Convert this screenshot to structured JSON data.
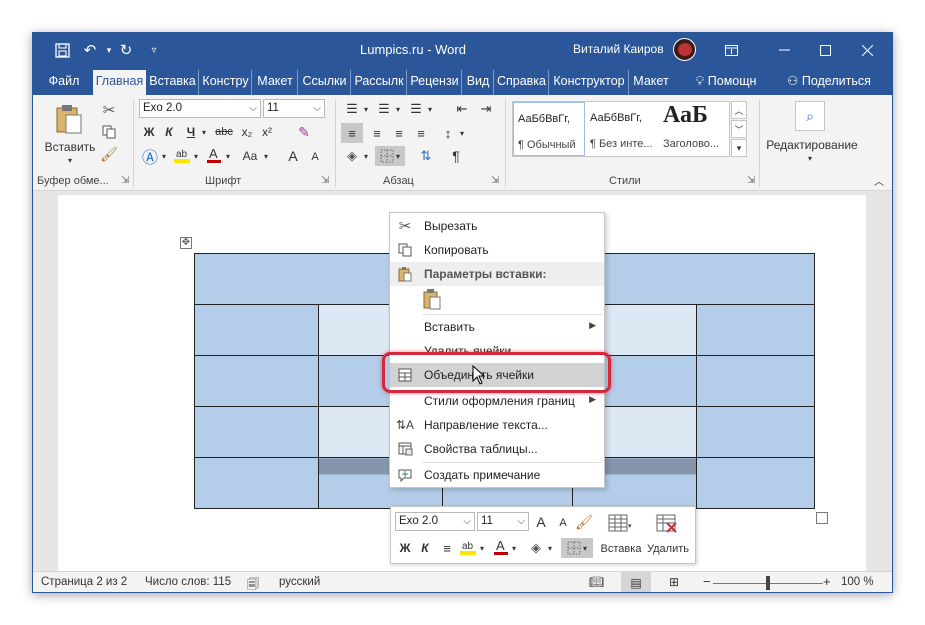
{
  "window": {
    "title": "Lumpics.ru  -  Word",
    "user_name": "Виталий Каиров"
  },
  "tabs": [
    {
      "label": "Файл",
      "active": false
    },
    {
      "label": "Главная",
      "active": true
    },
    {
      "label": "Вставка",
      "active": false
    },
    {
      "label": "Констру",
      "active": false
    },
    {
      "label": "Макет",
      "active": false
    },
    {
      "label": "Ссылки",
      "active": false
    },
    {
      "label": "Рассылк",
      "active": false
    },
    {
      "label": "Рецензи",
      "active": false
    },
    {
      "label": "Вид",
      "active": false
    },
    {
      "label": "Справка",
      "active": false
    },
    {
      "label": "Конструктор",
      "active": false
    },
    {
      "label": "Макет",
      "active": false
    }
  ],
  "tell_me": "Помощн",
  "share": "Поделиться",
  "ribbon": {
    "clipboard": {
      "paste_label": "Вставить",
      "group_label": "Буфер обме..."
    },
    "font": {
      "font_name": "Exo 2.0",
      "font_size": "11",
      "bold": "Ж",
      "italic": "К",
      "underline": "Ч",
      "strike": "abc",
      "subscript": "x₂",
      "superscript": "x²",
      "grow": "A",
      "shrink": "A",
      "case": "Aa",
      "group_label": "Шрифт"
    },
    "paragraph": {
      "group_label": "Абзац",
      "pilcrow": "¶"
    },
    "styles": {
      "items": [
        {
          "sample": "АаБбВвГг,",
          "name": "¶ Обычный"
        },
        {
          "sample": "АаБбВвГг,",
          "name": "¶ Без инте..."
        },
        {
          "sample": "АаБ",
          "name": "Заголово..."
        }
      ],
      "group_label": "Стили"
    },
    "editing": {
      "label": "Редактирование"
    }
  },
  "context_menu": {
    "items": [
      {
        "label": "Вырезать",
        "icon": "scissors-icon"
      },
      {
        "label": "Копировать",
        "icon": "copy-icon"
      },
      {
        "label": "Параметры вставки:",
        "icon": "paste-icon"
      },
      {
        "label": "Вставить",
        "submenu": true
      },
      {
        "label": "Удалить ячейки..."
      },
      {
        "label": "Объединить ячейки",
        "icon": "merge-cells-icon"
      },
      {
        "label": "Стили оформления границ",
        "submenu": true
      },
      {
        "label": "Направление текста...",
        "icon": "text-direction-icon"
      },
      {
        "label": "Свойства таблицы...",
        "icon": "table-properties-icon"
      },
      {
        "label": "Создать примечание",
        "icon": "comment-icon"
      }
    ]
  },
  "mini_toolbar": {
    "font_name": "Exo 2.0",
    "font_size": "11",
    "bold": "Ж",
    "italic": "К",
    "insert_label": "Вставка",
    "delete_label": "Удалить"
  },
  "status_bar": {
    "page": "Страница 2 из 2",
    "words": "Число слов: 115",
    "language": "русский",
    "zoom": "100 %",
    "zoom_level": 0.5
  },
  "colors": {
    "accent": "#2b579a",
    "table_fill": "#b4cde8",
    "table_fill_light": "#dde8f5",
    "highlight_ring": "#d6283a",
    "font_color_red": "#c00000",
    "highlight_yellow": "#ffe400"
  }
}
